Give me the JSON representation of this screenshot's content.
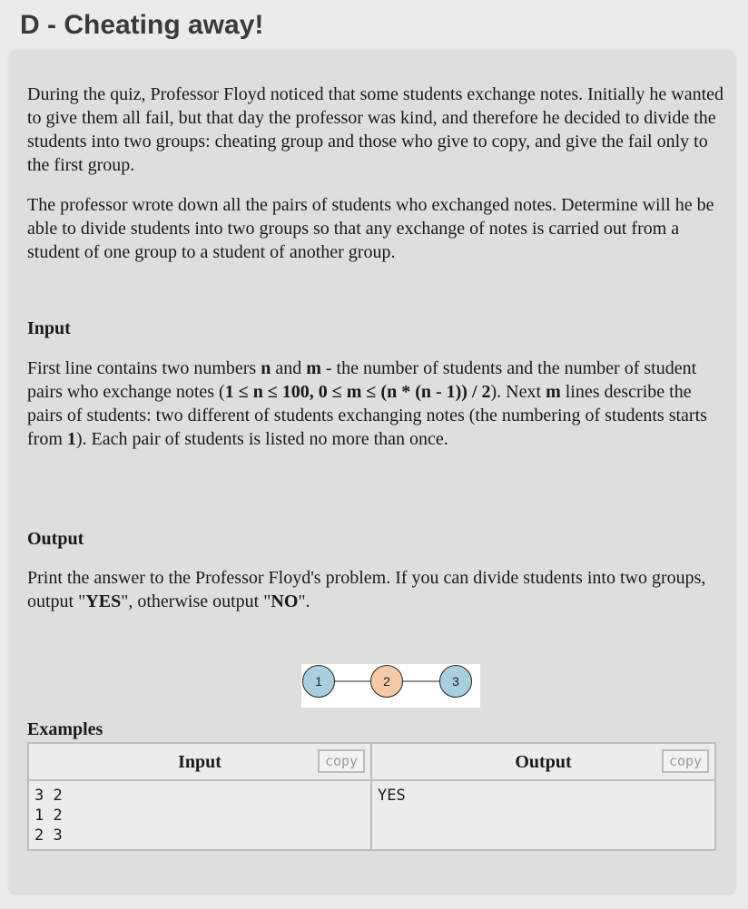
{
  "title": "D - Cheating away!",
  "statement": {
    "p1": "During the quiz, Professor Floyd noticed that some students exchange notes. Initially he wanted to give them all fail, but that day the professor was kind, and therefore he decided to divide the students into two groups: cheating group and those who give to copy, and give the fail only to the first group.",
    "p2": "The professor wrote down all the pairs of students who exchanged notes. Determine will he be able to divide students into two groups so that any exchange of notes is carried out from a student of one group to a student of another group."
  },
  "input_section": {
    "heading": "Input",
    "t1": "First line contains two numbers ",
    "n": "n",
    "t2": " and ",
    "m": "m",
    "t3": " - the number of students and the number of student pairs who exchange notes (",
    "constraint": "1 ≤ n ≤ 100, 0 ≤ m ≤ (n * (n - 1)) / 2",
    "t4": "). Next ",
    "m2": "m",
    "t5": " lines describe the pairs of students: two different of students exchanging notes (the numbering of students starts from ",
    "one": "1",
    "t6": "). Each pair of students is listed no more than once."
  },
  "output_section": {
    "heading": "Output",
    "t1": "Print the answer to the Professor Floyd's problem. If you can divide students into two groups, output \"",
    "yes": "YES",
    "t2": "\", otherwise output \"",
    "no": "NO",
    "t3": "\"."
  },
  "graph": {
    "nodes": [
      {
        "label": "1",
        "color": "#a9cfdf"
      },
      {
        "label": "2",
        "color": "#f5c9a5"
      },
      {
        "label": "3",
        "color": "#a9cfdf"
      }
    ]
  },
  "examples": {
    "heading": "Examples",
    "input_header": "Input",
    "output_header": "Output",
    "copy_label": "copy",
    "input_text": "3 2\n1 2\n2 3",
    "output_text": "YES"
  }
}
